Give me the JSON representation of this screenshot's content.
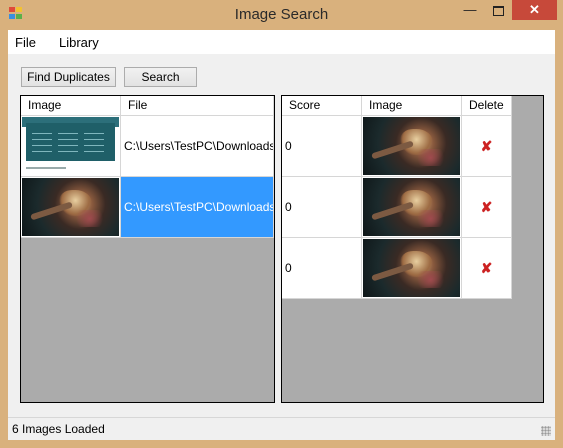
{
  "window": {
    "title": "Image Search"
  },
  "titlebar_controls": {
    "minimize": "—",
    "close": "✕"
  },
  "menu": {
    "file": "File",
    "library": "Library"
  },
  "toolbar": {
    "find_duplicates": "Find Duplicates",
    "search": "Search"
  },
  "library_grid": {
    "columns": {
      "image": "Image",
      "file": "File"
    },
    "rows": [
      {
        "image": "webpage-thumbnail",
        "file": "C:\\Users\\TestPC\\Downloads\\",
        "selected": false
      },
      {
        "image": "warrior-artwork-thumbnail",
        "file": "C:\\Users\\TestPC\\Downloads\\",
        "selected": true
      }
    ]
  },
  "results_grid": {
    "columns": {
      "score": "Score",
      "image": "Image",
      "delete": "Delete"
    },
    "rows": [
      {
        "score": "0",
        "image": "warrior-artwork-thumbnail",
        "delete_icon": "red-x-icon"
      },
      {
        "score": "0",
        "image": "warrior-artwork-thumbnail",
        "delete_icon": "red-x-icon"
      },
      {
        "score": "0",
        "image": "warrior-artwork-thumbnail",
        "delete_icon": "red-x-icon"
      }
    ]
  },
  "status": {
    "text": "6 Images Loaded"
  },
  "colors": {
    "selection": "#3399ff",
    "grid_background": "#ababab",
    "frame": "#d9b17d",
    "close_button": "#c7493a",
    "delete_icon": "#cc2222"
  }
}
